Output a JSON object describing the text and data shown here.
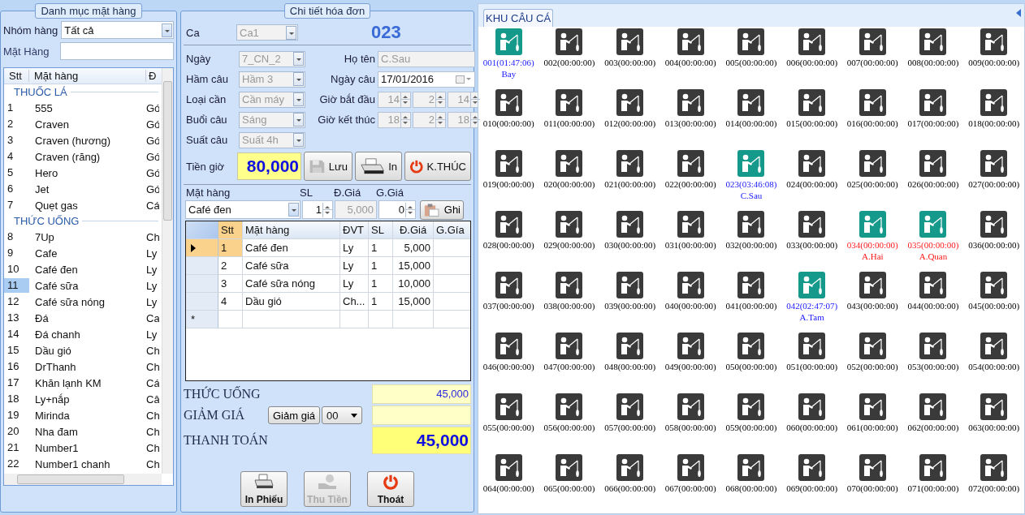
{
  "catalog": {
    "title": "Danh mục mặt hàng",
    "group_label": "Nhóm hàng",
    "group_value": "Tất cả",
    "item_label": "Mặt Hàng",
    "columns": [
      "Stt",
      "Mặt hàng",
      "Đ"
    ],
    "groups": [
      {
        "name": "THUỐC LÁ",
        "items": [
          {
            "stt": "1",
            "name": "555",
            "unit": "Gó",
            "selected": false
          },
          {
            "stt": "2",
            "name": "Craven",
            "unit": "Gó",
            "selected": false
          },
          {
            "stt": "3",
            "name": "Craven (hương)",
            "unit": "Gó",
            "selected": false
          },
          {
            "stt": "4",
            "name": "Craven (răng)",
            "unit": "Gó",
            "selected": false
          },
          {
            "stt": "5",
            "name": "Hero",
            "unit": "Gó",
            "selected": false
          },
          {
            "stt": "6",
            "name": "Jet",
            "unit": "Gó",
            "selected": false
          },
          {
            "stt": "7",
            "name": "Quẹt gas",
            "unit": "Cá",
            "selected": false
          }
        ]
      },
      {
        "name": "THỨC UỐNG",
        "items": [
          {
            "stt": "8",
            "name": "7Up",
            "unit": "Ch",
            "selected": false
          },
          {
            "stt": "9",
            "name": "Cafe",
            "unit": "Ly",
            "selected": false
          },
          {
            "stt": "10",
            "name": "Café đen",
            "unit": "Ly",
            "selected": false
          },
          {
            "stt": "11",
            "name": "Café sữa",
            "unit": "Ly",
            "selected": true
          },
          {
            "stt": "12",
            "name": "Café sữa nóng",
            "unit": "Ly",
            "selected": false
          },
          {
            "stt": "13",
            "name": "Đá",
            "unit": "Ca",
            "selected": false
          },
          {
            "stt": "14",
            "name": "Đá chanh",
            "unit": "Ly",
            "selected": false
          },
          {
            "stt": "15",
            "name": "Dầu gió",
            "unit": "Ch",
            "selected": false
          },
          {
            "stt": "16",
            "name": "DrThanh",
            "unit": "Ch",
            "selected": false
          },
          {
            "stt": "17",
            "name": "Khăn lạnh KM",
            "unit": "Cá",
            "selected": false
          },
          {
            "stt": "18",
            "name": "Ly+nắp",
            "unit": "Câ",
            "selected": false
          },
          {
            "stt": "19",
            "name": "Mirinda",
            "unit": "Ch",
            "selected": false
          },
          {
            "stt": "20",
            "name": "Nha đam",
            "unit": "Ch",
            "selected": false
          },
          {
            "stt": "21",
            "name": "Number1",
            "unit": "Ch",
            "selected": false
          },
          {
            "stt": "22",
            "name": "Number1 chanh",
            "unit": "Ch",
            "selected": false
          }
        ]
      }
    ]
  },
  "invoice": {
    "title": "Chi tiết hóa đơn",
    "ca_label": "Ca",
    "ca_value": "Ca1",
    "spot_number": "023",
    "left_fields": [
      {
        "label": "Ngày",
        "value": "7_CN_2",
        "disabled": true
      },
      {
        "label": "Hầm câu",
        "value": "Hầm 3",
        "disabled": true
      },
      {
        "label": "Loại cần",
        "value": "Cần máy",
        "disabled": true
      },
      {
        "label": "Buổi câu",
        "value": "Sáng",
        "disabled": true
      },
      {
        "label": "Suất câu",
        "value": "Suất 4h",
        "disabled": true
      }
    ],
    "name_label": "Họ tên",
    "name_value": "C.Sau",
    "date_label": "Ngày câu",
    "date_value": "17/01/2016",
    "times": [
      {
        "label": "Giờ bắt đầu",
        "values": [
          "14",
          "2",
          "14"
        ]
      },
      {
        "label": "Giờ kết thúc",
        "values": [
          "18",
          "2",
          "18"
        ]
      }
    ],
    "fee_label": "Tiền giờ",
    "fee_value": "80,000",
    "actions": [
      {
        "label": "Lưu",
        "kind": "save",
        "disabled": false
      },
      {
        "label": "In",
        "kind": "print",
        "disabled": false
      },
      {
        "label": "K.THÚC",
        "kind": "power",
        "disabled": false
      }
    ],
    "entry": {
      "item_label": "Mặt hàng",
      "item_value": "Café đen",
      "qty_label": "SL",
      "qty_value": "1",
      "price_label": "Đ.Giá",
      "price_value": "5,000",
      "discount_label": "G.Giá",
      "discount_value": "0",
      "record_button": "Ghi"
    },
    "columns": [
      "Stt",
      "Mặt hàng",
      "ĐVT",
      "SL",
      "Đ.Giá",
      "G.Gía"
    ],
    "rows": [
      {
        "cells": [
          "1",
          "Café đen",
          "Ly",
          "1",
          "5,000"
        ],
        "selected": true
      },
      {
        "cells": [
          "2",
          "Café sữa",
          "Ly",
          "1",
          "15,000"
        ],
        "selected": false
      },
      {
        "cells": [
          "3",
          "Café sữa nóng",
          "Ly",
          "1",
          "10,000"
        ],
        "selected": false
      },
      {
        "cells": [
          "4",
          "Dầu gió",
          "Ch...",
          "1",
          "15,000"
        ],
        "selected": false
      }
    ],
    "new_row_mark": "*",
    "drinks_label": "THỨC UỐNG",
    "drinks_total": "45,000",
    "discount_label": "GIẢM GIÁ",
    "discount_button": "Giảm giá",
    "discount_option": "00",
    "pay_label": "THANH TOÁN",
    "pay_total": "45,000",
    "bottom_buttons": [
      {
        "label": "In Phiếu",
        "kind": "print",
        "disabled": false
      },
      {
        "label": "Thu Tiền",
        "kind": "money",
        "disabled": true
      },
      {
        "label": "Thoát",
        "kind": "power",
        "disabled": false
      }
    ]
  },
  "area": {
    "tab": "KHU CÂU CÁ",
    "spots": [
      {
        "label": "001(01:47:06)",
        "name": "Bay",
        "occupied": true,
        "overdue": false
      },
      {
        "label": "002(00:00:00)",
        "occupied": false,
        "overdue": false
      },
      {
        "label": "003(00:00:00)",
        "occupied": false,
        "overdue": false
      },
      {
        "label": "004(00:00:00)",
        "occupied": false,
        "overdue": false
      },
      {
        "label": "005(00:00:00)",
        "occupied": false,
        "overdue": false
      },
      {
        "label": "006(00:00:00)",
        "occupied": false,
        "overdue": false
      },
      {
        "label": "007(00:00:00)",
        "occupied": false,
        "overdue": false
      },
      {
        "label": "008(00:00:00)",
        "occupied": false,
        "overdue": false
      },
      {
        "label": "009(00:00:00)",
        "occupied": false,
        "overdue": false
      },
      {
        "label": "010(00:00:00)",
        "occupied": false,
        "overdue": false
      },
      {
        "label": "011(00:00:00)",
        "occupied": false,
        "overdue": false
      },
      {
        "label": "012(00:00:00)",
        "occupied": false,
        "overdue": false
      },
      {
        "label": "013(00:00:00)",
        "occupied": false,
        "overdue": false
      },
      {
        "label": "014(00:00:00)",
        "occupied": false,
        "overdue": false
      },
      {
        "label": "015(00:00:00)",
        "occupied": false,
        "overdue": false
      },
      {
        "label": "016(00:00:00)",
        "occupied": false,
        "overdue": false
      },
      {
        "label": "017(00:00:00)",
        "occupied": false,
        "overdue": false
      },
      {
        "label": "018(00:00:00)",
        "occupied": false,
        "overdue": false
      },
      {
        "label": "019(00:00:00)",
        "occupied": false,
        "overdue": false
      },
      {
        "label": "020(00:00:00)",
        "occupied": false,
        "overdue": false
      },
      {
        "label": "021(00:00:00)",
        "occupied": false,
        "overdue": false
      },
      {
        "label": "022(00:00:00)",
        "occupied": false,
        "overdue": false
      },
      {
        "label": "023(03:46:08)",
        "name": "C.Sau",
        "occupied": true,
        "overdue": false
      },
      {
        "label": "024(00:00:00)",
        "occupied": false,
        "overdue": false
      },
      {
        "label": "025(00:00:00)",
        "occupied": false,
        "overdue": false
      },
      {
        "label": "026(00:00:00)",
        "occupied": false,
        "overdue": false
      },
      {
        "label": "027(00:00:00)",
        "occupied": false,
        "overdue": false
      },
      {
        "label": "028(00:00:00)",
        "occupied": false,
        "overdue": false
      },
      {
        "label": "029(00:00:00)",
        "occupied": false,
        "overdue": false
      },
      {
        "label": "030(00:00:00)",
        "occupied": false,
        "overdue": false
      },
      {
        "label": "031(00:00:00)",
        "occupied": false,
        "overdue": false
      },
      {
        "label": "032(00:00:00)",
        "occupied": false,
        "overdue": false
      },
      {
        "label": "033(00:00:00)",
        "occupied": false,
        "overdue": false
      },
      {
        "label": "034(00:00:00)",
        "name": "A.Hai",
        "occupied": true,
        "overdue": true
      },
      {
        "label": "035(00:00:00)",
        "name": "A.Quan",
        "occupied": true,
        "overdue": true
      },
      {
        "label": "036(00:00:00)",
        "occupied": false,
        "overdue": false
      },
      {
        "label": "037(00:00:00)",
        "occupied": false,
        "overdue": false
      },
      {
        "label": "038(00:00:00)",
        "occupied": false,
        "overdue": false
      },
      {
        "label": "039(00:00:00)",
        "occupied": false,
        "overdue": false
      },
      {
        "label": "040(00:00:00)",
        "occupied": false,
        "overdue": false
      },
      {
        "label": "041(00:00:00)",
        "occupied": false,
        "overdue": false
      },
      {
        "label": "042(02:47:07)",
        "name": "A.Tam",
        "occupied": true,
        "overdue": false
      },
      {
        "label": "043(00:00:00)",
        "occupied": false,
        "overdue": false
      },
      {
        "label": "044(00:00:00)",
        "occupied": false,
        "overdue": false
      },
      {
        "label": "045(00:00:00)",
        "occupied": false,
        "overdue": false
      },
      {
        "label": "046(00:00:00)",
        "occupied": false,
        "overdue": false
      },
      {
        "label": "047(00:00:00)",
        "occupied": false,
        "overdue": false
      },
      {
        "label": "048(00:00:00)",
        "occupied": false,
        "overdue": false
      },
      {
        "label": "049(00:00:00)",
        "occupied": false,
        "overdue": false
      },
      {
        "label": "050(00:00:00)",
        "occupied": false,
        "overdue": false
      },
      {
        "label": "051(00:00:00)",
        "occupied": false,
        "overdue": false
      },
      {
        "label": "052(00:00:00)",
        "occupied": false,
        "overdue": false
      },
      {
        "label": "053(00:00:00)",
        "occupied": false,
        "overdue": false
      },
      {
        "label": "054(00:00:00)",
        "occupied": false,
        "overdue": false
      },
      {
        "label": "055(00:00:00)",
        "occupied": false,
        "overdue": false
      },
      {
        "label": "056(00:00:00)",
        "occupied": false,
        "overdue": false
      },
      {
        "label": "057(00:00:00)",
        "occupied": false,
        "overdue": false
      },
      {
        "label": "058(00:00:00)",
        "occupied": false,
        "overdue": false
      },
      {
        "label": "059(00:00:00)",
        "occupied": false,
        "overdue": false
      },
      {
        "label": "060(00:00:00)",
        "occupied": false,
        "overdue": false
      },
      {
        "label": "061(00:00:00)",
        "occupied": false,
        "overdue": false
      },
      {
        "label": "062(00:00:00)",
        "occupied": false,
        "overdue": false
      },
      {
        "label": "063(00:00:00)",
        "occupied": false,
        "overdue": false
      },
      {
        "label": "064(00:00:00)",
        "occupied": false,
        "overdue": false
      },
      {
        "label": "065(00:00:00)",
        "occupied": false,
        "overdue": false
      },
      {
        "label": "066(00:00:00)",
        "occupied": false,
        "overdue": false
      },
      {
        "label": "067(00:00:00)",
        "occupied": false,
        "overdue": false
      },
      {
        "label": "068(00:00:00)",
        "occupied": false,
        "overdue": false
      },
      {
        "label": "069(00:00:00)",
        "occupied": false,
        "overdue": false
      },
      {
        "label": "070(00:00:00)",
        "occupied": false,
        "overdue": false
      },
      {
        "label": "071(00:00:00)",
        "occupied": false,
        "overdue": false
      },
      {
        "label": "072(00:00:00)",
        "occupied": false,
        "overdue": false
      }
    ]
  }
}
